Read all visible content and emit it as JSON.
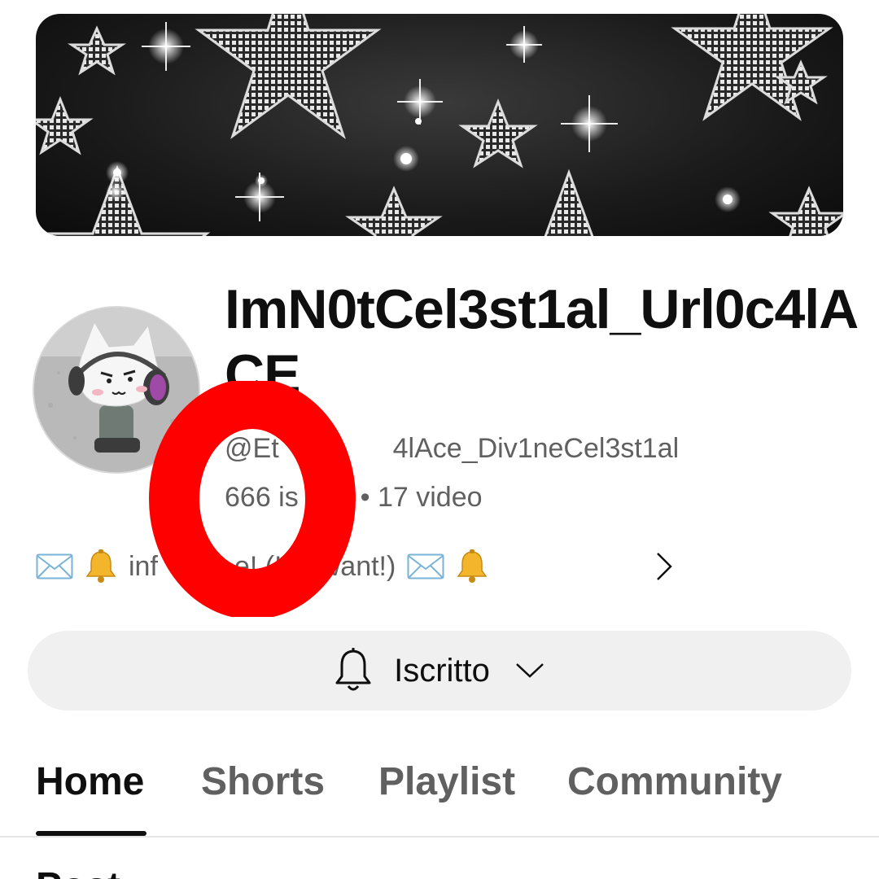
{
  "channel": {
    "name": "ImN0tCel3st1al_Url0c4lACE",
    "handle": "@Etr...e4lAce_Div1neCel3st1al",
    "handle_parts": {
      "start": "@Et",
      "end": "4lAce_Div1neCel3st1al"
    },
    "stats_parts": {
      "start": "666 is",
      "end": "tti • 17 video"
    },
    "description_parts": {
      "start": "inf",
      "end": "e! (If u want!)"
    },
    "description_prefix_icons": [
      "envelope-icon",
      "bell-icon"
    ],
    "description_suffix_icons": [
      "envelope-icon",
      "bell-icon"
    ]
  },
  "subscribe": {
    "label": "Iscritto",
    "icon": "bell-icon",
    "dropdown_icon": "chevron-down-icon"
  },
  "tabs": [
    {
      "label": "Home",
      "active": true
    },
    {
      "label": "Shorts",
      "active": false
    },
    {
      "label": "Playlist",
      "active": false
    },
    {
      "label": "Community",
      "active": false
    }
  ],
  "next_section": {
    "heading": "Post"
  },
  "overlay": {
    "glyph": "O",
    "color": "#ff0000"
  },
  "colors": {
    "text_primary": "#0f0f0f",
    "text_secondary": "#606060",
    "button_bg": "#f0f0f0",
    "overlay_red": "#ff0000"
  }
}
